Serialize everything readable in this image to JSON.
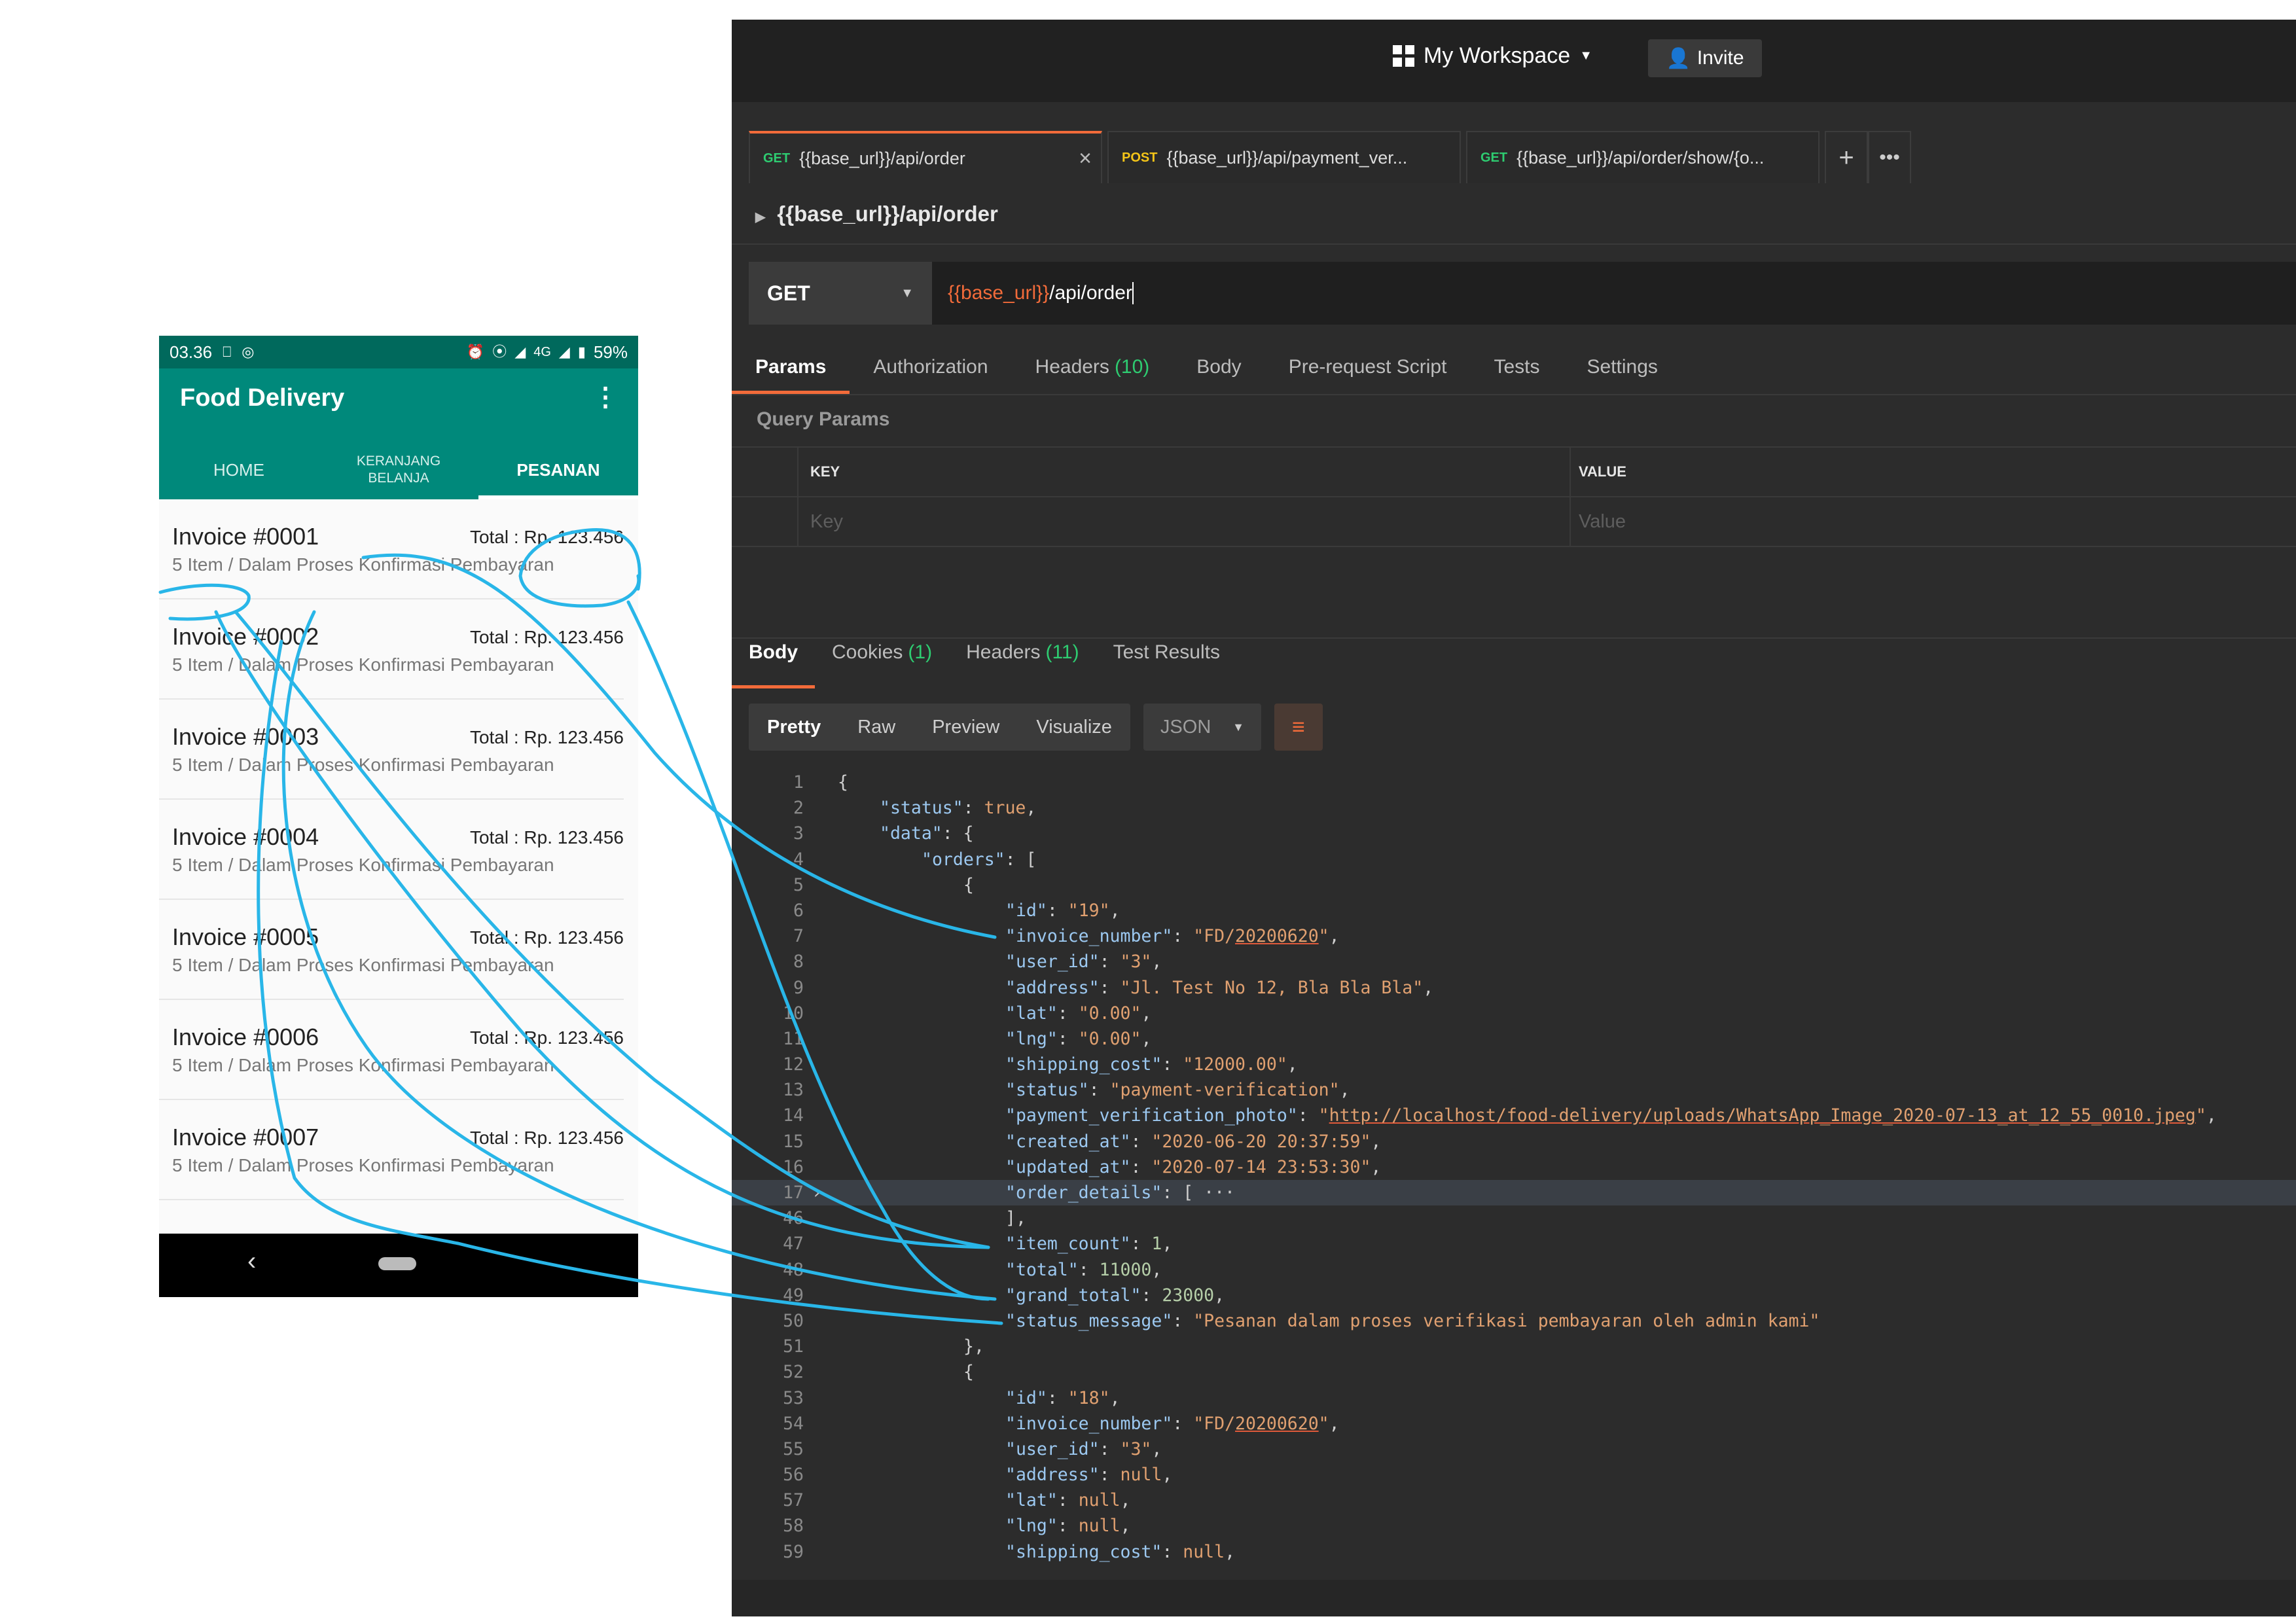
{
  "phone": {
    "status": {
      "time": "03.36",
      "signal": "4G",
      "battery": "59%"
    },
    "app_title": "Food Delivery",
    "tabs": [
      {
        "label": "HOME"
      },
      {
        "label": "KERANJANG BELANJA"
      },
      {
        "label": "PESANAN"
      }
    ],
    "invoices": [
      {
        "title": "Invoice #0001",
        "total": "Total : Rp. 123.456",
        "subtitle": "5 Item / Dalam Proses Konfirmasi Pembayaran"
      },
      {
        "title": "Invoice #0002",
        "total": "Total : Rp. 123.456",
        "subtitle": "5 Item / Dalam Proses Konfirmasi Pembayaran"
      },
      {
        "title": "Invoice #0003",
        "total": "Total : Rp. 123.456",
        "subtitle": "5 Item / Dalam Proses Konfirmasi Pembayaran"
      },
      {
        "title": "Invoice #0004",
        "total": "Total : Rp. 123.456",
        "subtitle": "5 Item / Dalam Proses Konfirmasi Pembayaran"
      },
      {
        "title": "Invoice #0005",
        "total": "Total : Rp. 123.456",
        "subtitle": "5 Item / Dalam Proses Konfirmasi Pembayaran"
      },
      {
        "title": "Invoice #0006",
        "total": "Total : Rp. 123.456",
        "subtitle": "5 Item / Dalam Proses Konfirmasi Pembayaran"
      },
      {
        "title": "Invoice #0007",
        "total": "Total : Rp. 123.456",
        "subtitle": "5 Item / Dalam Proses Konfirmasi Pembayaran"
      }
    ],
    "nav": {
      "back": "‹"
    }
  },
  "postman": {
    "workspace": "My Workspace",
    "invite": "Invite",
    "request_tabs": [
      {
        "method": "GET",
        "label": "{{base_url}}/api/order"
      },
      {
        "method": "POST",
        "label": "{{base_url}}/api/payment_ver..."
      },
      {
        "method": "GET",
        "label": "{{base_url}}/api/order/show/{o..."
      }
    ],
    "breadcrumb": "{{base_url}}/api/order",
    "method": "GET",
    "url": {
      "var": "{{base_url}}",
      "path": "/api/order"
    },
    "request_subtabs": [
      {
        "label": "Params",
        "count": ""
      },
      {
        "label": "Authorization",
        "count": ""
      },
      {
        "label": "Headers",
        "count": "(10)"
      },
      {
        "label": "Body",
        "count": ""
      },
      {
        "label": "Pre-request Script",
        "count": ""
      },
      {
        "label": "Tests",
        "count": ""
      },
      {
        "label": "Settings",
        "count": ""
      }
    ],
    "query_params_title": "Query Params",
    "params_table": {
      "key_header": "KEY",
      "value_header": "VALUE",
      "key_placeholder": "Key",
      "value_placeholder": "Value"
    },
    "response_tabs": [
      {
        "label": "Body",
        "count": ""
      },
      {
        "label": "Cookies",
        "count": "(1)"
      },
      {
        "label": "Headers",
        "count": "(11)"
      },
      {
        "label": "Test Results",
        "count": ""
      }
    ],
    "view_modes": [
      "Pretty",
      "Raw",
      "Preview",
      "Visualize"
    ],
    "format": "JSON",
    "code_lines": [
      {
        "no": "1",
        "ind": 0,
        "parts": [
          [
            "p",
            "{"
          ]
        ]
      },
      {
        "no": "2",
        "ind": 1,
        "parts": [
          [
            "k",
            "\"status\""
          ],
          [
            "p",
            ": "
          ],
          [
            "b",
            "true"
          ],
          [
            "p",
            ","
          ]
        ]
      },
      {
        "no": "3",
        "ind": 1,
        "parts": [
          [
            "k",
            "\"data\""
          ],
          [
            "p",
            ": {"
          ]
        ]
      },
      {
        "no": "4",
        "ind": 2,
        "parts": [
          [
            "k",
            "\"orders\""
          ],
          [
            "p",
            ": ["
          ]
        ]
      },
      {
        "no": "5",
        "ind": 3,
        "parts": [
          [
            "p",
            "{"
          ]
        ]
      },
      {
        "no": "6",
        "ind": 4,
        "parts": [
          [
            "k",
            "\"id\""
          ],
          [
            "p",
            ": "
          ],
          [
            "s",
            "\"19\""
          ],
          [
            "p",
            ","
          ]
        ]
      },
      {
        "no": "7",
        "ind": 4,
        "parts": [
          [
            "k",
            "\"invoice_number\""
          ],
          [
            "p",
            ": "
          ],
          [
            "s",
            "\"FD/"
          ],
          [
            "su",
            "20200620"
          ],
          [
            "s",
            "\""
          ],
          [
            "p",
            ","
          ]
        ]
      },
      {
        "no": "8",
        "ind": 4,
        "parts": [
          [
            "k",
            "\"user_id\""
          ],
          [
            "p",
            ": "
          ],
          [
            "s",
            "\"3\""
          ],
          [
            "p",
            ","
          ]
        ]
      },
      {
        "no": "9",
        "ind": 4,
        "parts": [
          [
            "k",
            "\"address\""
          ],
          [
            "p",
            ": "
          ],
          [
            "s",
            "\"Jl. Test No 12, Bla Bla Bla\""
          ],
          [
            "p",
            ","
          ]
        ]
      },
      {
        "no": "10",
        "ind": 4,
        "parts": [
          [
            "k",
            "\"lat\""
          ],
          [
            "p",
            ": "
          ],
          [
            "s",
            "\"0.00\""
          ],
          [
            "p",
            ","
          ]
        ]
      },
      {
        "no": "11",
        "ind": 4,
        "parts": [
          [
            "k",
            "\"lng\""
          ],
          [
            "p",
            ": "
          ],
          [
            "s",
            "\"0.00\""
          ],
          [
            "p",
            ","
          ]
        ]
      },
      {
        "no": "12",
        "ind": 4,
        "parts": [
          [
            "k",
            "\"shipping_cost\""
          ],
          [
            "p",
            ": "
          ],
          [
            "s",
            "\"12000.00\""
          ],
          [
            "p",
            ","
          ]
        ]
      },
      {
        "no": "13",
        "ind": 4,
        "parts": [
          [
            "k",
            "\"status\""
          ],
          [
            "p",
            ": "
          ],
          [
            "s",
            "\"payment-verification\""
          ],
          [
            "p",
            ","
          ]
        ]
      },
      {
        "no": "14",
        "ind": 4,
        "parts": [
          [
            "k",
            "\"payment_verification_photo\""
          ],
          [
            "p",
            ": "
          ],
          [
            "s",
            "\""
          ],
          [
            "su",
            "http://localhost/food-delivery/uploads/WhatsApp_Image_2020-07-13_at_12_55_0010.jpeg"
          ],
          [
            "s",
            "\""
          ],
          [
            "p",
            ","
          ]
        ]
      },
      {
        "no": "15",
        "ind": 4,
        "parts": [
          [
            "k",
            "\"created_at\""
          ],
          [
            "p",
            ": "
          ],
          [
            "s",
            "\"2020-06-20 20:37:59\""
          ],
          [
            "p",
            ","
          ]
        ]
      },
      {
        "no": "16",
        "ind": 4,
        "parts": [
          [
            "k",
            "\"updated_at\""
          ],
          [
            "p",
            ": "
          ],
          [
            "s",
            "\"2020-07-14 23:53:30\""
          ],
          [
            "p",
            ","
          ]
        ]
      },
      {
        "no": "17",
        "ind": 4,
        "hl": true,
        "fold": true,
        "parts": [
          [
            "k",
            "\"order_details\""
          ],
          [
            "p",
            ": [ ···"
          ]
        ]
      },
      {
        "no": "46",
        "ind": 4,
        "parts": [
          [
            "p",
            "],"
          ]
        ]
      },
      {
        "no": "47",
        "ind": 4,
        "parts": [
          [
            "k",
            "\"item_count\""
          ],
          [
            "p",
            ": "
          ],
          [
            "n",
            "1"
          ],
          [
            "p",
            ","
          ]
        ]
      },
      {
        "no": "48",
        "ind": 4,
        "parts": [
          [
            "k",
            "\"total\""
          ],
          [
            "p",
            ": "
          ],
          [
            "n",
            "11000"
          ],
          [
            "p",
            ","
          ]
        ]
      },
      {
        "no": "49",
        "ind": 4,
        "parts": [
          [
            "k",
            "\"grand_total\""
          ],
          [
            "p",
            ": "
          ],
          [
            "n",
            "23000"
          ],
          [
            "p",
            ","
          ]
        ]
      },
      {
        "no": "50",
        "ind": 4,
        "parts": [
          [
            "k",
            "\"status_message\""
          ],
          [
            "p",
            ": "
          ],
          [
            "s",
            "\"Pesanan dalam proses verifikasi pembayaran oleh admin kami\""
          ]
        ]
      },
      {
        "no": "51",
        "ind": 3,
        "parts": [
          [
            "p",
            "},"
          ]
        ]
      },
      {
        "no": "52",
        "ind": 3,
        "parts": [
          [
            "p",
            "{"
          ]
        ]
      },
      {
        "no": "53",
        "ind": 4,
        "parts": [
          [
            "k",
            "\"id\""
          ],
          [
            "p",
            ": "
          ],
          [
            "s",
            "\"18\""
          ],
          [
            "p",
            ","
          ]
        ]
      },
      {
        "no": "54",
        "ind": 4,
        "parts": [
          [
            "k",
            "\"invoice_number\""
          ],
          [
            "p",
            ": "
          ],
          [
            "s",
            "\"FD/"
          ],
          [
            "su",
            "20200620"
          ],
          [
            "s",
            "\""
          ],
          [
            "p",
            ","
          ]
        ]
      },
      {
        "no": "55",
        "ind": 4,
        "parts": [
          [
            "k",
            "\"user_id\""
          ],
          [
            "p",
            ": "
          ],
          [
            "s",
            "\"3\""
          ],
          [
            "p",
            ","
          ]
        ]
      },
      {
        "no": "56",
        "ind": 4,
        "parts": [
          [
            "k",
            "\"address\""
          ],
          [
            "p",
            ": "
          ],
          [
            "b",
            "null"
          ],
          [
            "p",
            ","
          ]
        ]
      },
      {
        "no": "57",
        "ind": 4,
        "parts": [
          [
            "k",
            "\"lat\""
          ],
          [
            "p",
            ": "
          ],
          [
            "b",
            "null"
          ],
          [
            "p",
            ","
          ]
        ]
      },
      {
        "no": "58",
        "ind": 4,
        "parts": [
          [
            "k",
            "\"lng\""
          ],
          [
            "p",
            ": "
          ],
          [
            "b",
            "null"
          ],
          [
            "p",
            ","
          ]
        ]
      },
      {
        "no": "59",
        "ind": 4,
        "parts": [
          [
            "k",
            "\"shipping_cost\""
          ],
          [
            "p",
            ": "
          ],
          [
            "b",
            "null"
          ],
          [
            "p",
            ","
          ]
        ]
      }
    ]
  },
  "colors": {
    "phone_primary": "#00897b",
    "phone_status": "#00695c",
    "postman_bg": "#2c2c2c",
    "postman_accent": "#f26b3a",
    "annotation": "#29b6e8"
  }
}
